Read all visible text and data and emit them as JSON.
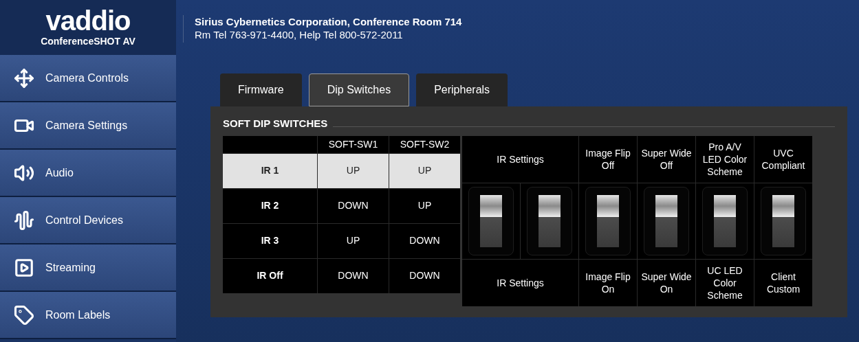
{
  "brand": {
    "logo": "vaddio",
    "product": "ConferenceSHOT AV"
  },
  "header": {
    "line1": "Sirius Cybernetics Corporation, Conference Room 714",
    "line2": "Rm Tel 763-971-4400, Help Tel 800-572-2011"
  },
  "sidebar": {
    "items": [
      {
        "label": "Camera Controls",
        "selected": false
      },
      {
        "label": "Camera Settings",
        "selected": false
      },
      {
        "label": "Audio",
        "selected": false
      },
      {
        "label": "Control Devices",
        "selected": false
      },
      {
        "label": "Streaming",
        "selected": false
      },
      {
        "label": "Room Labels",
        "selected": false
      }
    ]
  },
  "tabs": [
    {
      "label": "Firmware",
      "selected": false
    },
    {
      "label": "Dip Switches",
      "selected": true
    },
    {
      "label": "Peripherals",
      "selected": false
    }
  ],
  "panel": {
    "title": "SOFT DIP SWITCHES",
    "ir_table": {
      "columns": [
        "SOFT-SW1",
        "SOFT-SW2"
      ],
      "rows": [
        {
          "label": "IR 1",
          "values": [
            "UP",
            "UP"
          ],
          "selected": true
        },
        {
          "label": "IR 2",
          "values": [
            "DOWN",
            "UP"
          ],
          "selected": false
        },
        {
          "label": "IR 3",
          "values": [
            "UP",
            "DOWN"
          ],
          "selected": false
        },
        {
          "label": "IR Off",
          "values": [
            "DOWN",
            "DOWN"
          ],
          "selected": false
        }
      ]
    },
    "switch_groups": [
      {
        "top": "IR Settings",
        "bottom": "IR Settings",
        "switches": [
          {
            "up": true
          },
          {
            "up": true
          }
        ]
      },
      {
        "top": "Image Flip Off",
        "bottom": "Image Flip On",
        "switches": [
          {
            "up": true
          }
        ]
      },
      {
        "top": "Super Wide Off",
        "bottom": "Super Wide On",
        "switches": [
          {
            "up": true
          }
        ]
      },
      {
        "top": "Pro A/V LED Color Scheme",
        "bottom": "UC LED Color Scheme",
        "switches": [
          {
            "up": true
          }
        ]
      },
      {
        "top": "UVC Compliant",
        "bottom": "Client Custom",
        "switches": [
          {
            "up": true
          }
        ]
      }
    ]
  }
}
